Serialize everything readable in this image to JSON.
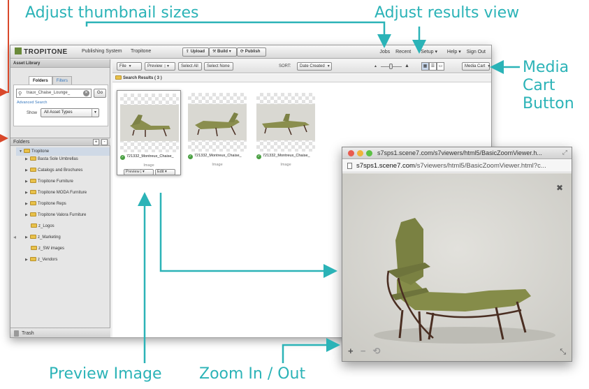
{
  "callouts": {
    "thumbnail_sizes": "Adjust thumbnail sizes",
    "results_view": "Adjust results view",
    "media_cart_line1": "Media",
    "media_cart_line2": "Cart",
    "media_cart_line3": "Button",
    "preview_image": "Preview Image",
    "zoom": "Zoom In / Out",
    "color": "#2bb3b7",
    "arrow_red": "#d9482b"
  },
  "header": {
    "brand": "TROPITONE",
    "product": "Publishing System",
    "company": "Tropitone",
    "upload": "Upload",
    "build": "Build",
    "publish": "Publish",
    "nav": [
      "Jobs",
      "Recent",
      "Setup",
      "Help",
      "Sign Out"
    ]
  },
  "sidebar": {
    "title": "Asset Library",
    "tabs": [
      "Folders",
      "Filters"
    ],
    "search_value": "traux_Chaise_Lounge_",
    "go": "Go",
    "advanced_search": "Advanced Search",
    "show_label": "Show",
    "asset_type": "All Asset Types",
    "folders_header": "Folders",
    "root": "Tropitone",
    "folders": [
      {
        "label": "Basta Sole Umbrellas",
        "expandable": true
      },
      {
        "label": "Catalogs and Brochures",
        "expandable": true
      },
      {
        "label": "Tropitone Furniture",
        "expandable": true
      },
      {
        "label": "Tropitone MODA Furniture",
        "expandable": true
      },
      {
        "label": "Tropitone Reps",
        "expandable": true
      },
      {
        "label": "Tropitone Valora Furniture",
        "expandable": true
      },
      {
        "label": "z_Logos",
        "expandable": false
      },
      {
        "label": "z_Marketing",
        "expandable": true
      },
      {
        "label": "z_SW images",
        "expandable": false
      },
      {
        "label": "z_Vendors",
        "expandable": true
      }
    ],
    "trash": "Trash"
  },
  "toolbar": {
    "file": "File",
    "preview": "Preview",
    "select_all": "Select All",
    "select_none": "Select None",
    "sort_label": "SORT:",
    "sort_value": "Date Created",
    "media_cart": "Media Cart"
  },
  "results": {
    "title": "Search Results ( 3 )",
    "items": [
      {
        "name": "721332_Montreux_Chaise_",
        "type": "Image",
        "preview": "Preview",
        "edit": "Edit"
      },
      {
        "name": "721332_Montreux_Chaise_",
        "type": "Image"
      },
      {
        "name": "721332_Montreux_Chaise_",
        "type": "Image"
      }
    ]
  },
  "popup": {
    "title": "s7sps1.scene7.com/s7viewers/html5/BasicZoomViewer.h...",
    "url_host": "s7sps1.scene7.com",
    "url_path": "/s7viewers/html5/BasicZoomViewer.html?c..."
  }
}
